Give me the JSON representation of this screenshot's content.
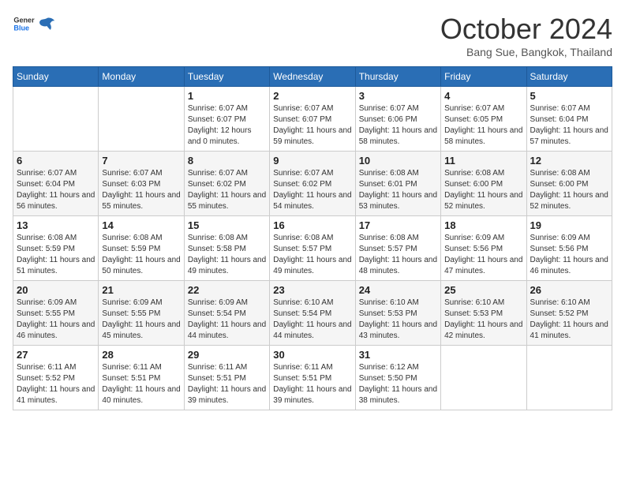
{
  "logo": {
    "general": "General",
    "blue": "Blue"
  },
  "header": {
    "month": "October 2024",
    "location": "Bang Sue, Bangkok, Thailand"
  },
  "days": [
    "Sunday",
    "Monday",
    "Tuesday",
    "Wednesday",
    "Thursday",
    "Friday",
    "Saturday"
  ],
  "weeks": [
    [
      {
        "day": "",
        "info": ""
      },
      {
        "day": "",
        "info": ""
      },
      {
        "day": "1",
        "info": "Sunrise: 6:07 AM\nSunset: 6:07 PM\nDaylight: 12 hours\nand 0 minutes."
      },
      {
        "day": "2",
        "info": "Sunrise: 6:07 AM\nSunset: 6:07 PM\nDaylight: 11 hours\nand 59 minutes."
      },
      {
        "day": "3",
        "info": "Sunrise: 6:07 AM\nSunset: 6:06 PM\nDaylight: 11 hours\nand 58 minutes."
      },
      {
        "day": "4",
        "info": "Sunrise: 6:07 AM\nSunset: 6:05 PM\nDaylight: 11 hours\nand 58 minutes."
      },
      {
        "day": "5",
        "info": "Sunrise: 6:07 AM\nSunset: 6:04 PM\nDaylight: 11 hours\nand 57 minutes."
      }
    ],
    [
      {
        "day": "6",
        "info": "Sunrise: 6:07 AM\nSunset: 6:04 PM\nDaylight: 11 hours\nand 56 minutes."
      },
      {
        "day": "7",
        "info": "Sunrise: 6:07 AM\nSunset: 6:03 PM\nDaylight: 11 hours\nand 55 minutes."
      },
      {
        "day": "8",
        "info": "Sunrise: 6:07 AM\nSunset: 6:02 PM\nDaylight: 11 hours\nand 55 minutes."
      },
      {
        "day": "9",
        "info": "Sunrise: 6:07 AM\nSunset: 6:02 PM\nDaylight: 11 hours\nand 54 minutes."
      },
      {
        "day": "10",
        "info": "Sunrise: 6:08 AM\nSunset: 6:01 PM\nDaylight: 11 hours\nand 53 minutes."
      },
      {
        "day": "11",
        "info": "Sunrise: 6:08 AM\nSunset: 6:00 PM\nDaylight: 11 hours\nand 52 minutes."
      },
      {
        "day": "12",
        "info": "Sunrise: 6:08 AM\nSunset: 6:00 PM\nDaylight: 11 hours\nand 52 minutes."
      }
    ],
    [
      {
        "day": "13",
        "info": "Sunrise: 6:08 AM\nSunset: 5:59 PM\nDaylight: 11 hours\nand 51 minutes."
      },
      {
        "day": "14",
        "info": "Sunrise: 6:08 AM\nSunset: 5:59 PM\nDaylight: 11 hours\nand 50 minutes."
      },
      {
        "day": "15",
        "info": "Sunrise: 6:08 AM\nSunset: 5:58 PM\nDaylight: 11 hours\nand 49 minutes."
      },
      {
        "day": "16",
        "info": "Sunrise: 6:08 AM\nSunset: 5:57 PM\nDaylight: 11 hours\nand 49 minutes."
      },
      {
        "day": "17",
        "info": "Sunrise: 6:08 AM\nSunset: 5:57 PM\nDaylight: 11 hours\nand 48 minutes."
      },
      {
        "day": "18",
        "info": "Sunrise: 6:09 AM\nSunset: 5:56 PM\nDaylight: 11 hours\nand 47 minutes."
      },
      {
        "day": "19",
        "info": "Sunrise: 6:09 AM\nSunset: 5:56 PM\nDaylight: 11 hours\nand 46 minutes."
      }
    ],
    [
      {
        "day": "20",
        "info": "Sunrise: 6:09 AM\nSunset: 5:55 PM\nDaylight: 11 hours\nand 46 minutes."
      },
      {
        "day": "21",
        "info": "Sunrise: 6:09 AM\nSunset: 5:55 PM\nDaylight: 11 hours\nand 45 minutes."
      },
      {
        "day": "22",
        "info": "Sunrise: 6:09 AM\nSunset: 5:54 PM\nDaylight: 11 hours\nand 44 minutes."
      },
      {
        "day": "23",
        "info": "Sunrise: 6:10 AM\nSunset: 5:54 PM\nDaylight: 11 hours\nand 44 minutes."
      },
      {
        "day": "24",
        "info": "Sunrise: 6:10 AM\nSunset: 5:53 PM\nDaylight: 11 hours\nand 43 minutes."
      },
      {
        "day": "25",
        "info": "Sunrise: 6:10 AM\nSunset: 5:53 PM\nDaylight: 11 hours\nand 42 minutes."
      },
      {
        "day": "26",
        "info": "Sunrise: 6:10 AM\nSunset: 5:52 PM\nDaylight: 11 hours\nand 41 minutes."
      }
    ],
    [
      {
        "day": "27",
        "info": "Sunrise: 6:11 AM\nSunset: 5:52 PM\nDaylight: 11 hours\nand 41 minutes."
      },
      {
        "day": "28",
        "info": "Sunrise: 6:11 AM\nSunset: 5:51 PM\nDaylight: 11 hours\nand 40 minutes."
      },
      {
        "day": "29",
        "info": "Sunrise: 6:11 AM\nSunset: 5:51 PM\nDaylight: 11 hours\nand 39 minutes."
      },
      {
        "day": "30",
        "info": "Sunrise: 6:11 AM\nSunset: 5:51 PM\nDaylight: 11 hours\nand 39 minutes."
      },
      {
        "day": "31",
        "info": "Sunrise: 6:12 AM\nSunset: 5:50 PM\nDaylight: 11 hours\nand 38 minutes."
      },
      {
        "day": "",
        "info": ""
      },
      {
        "day": "",
        "info": ""
      }
    ]
  ]
}
